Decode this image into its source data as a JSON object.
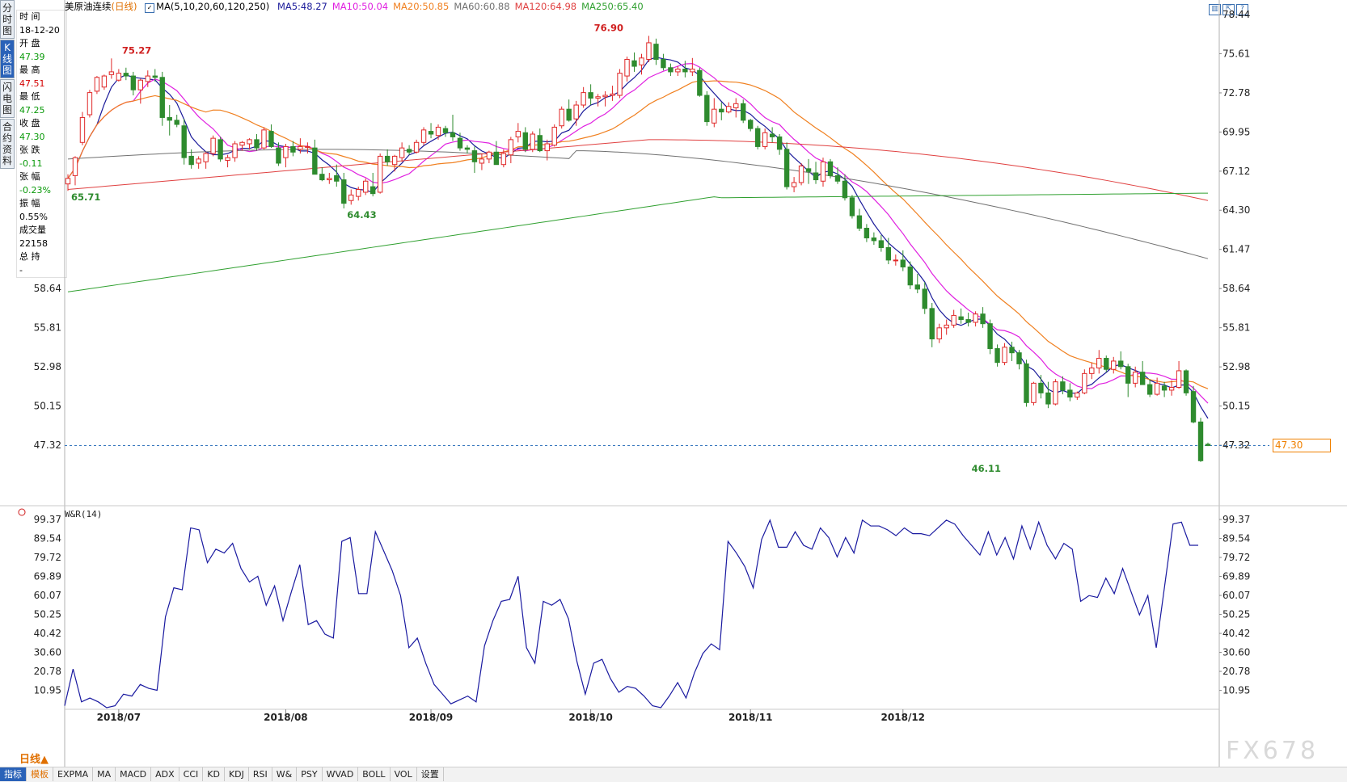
{
  "instrument": "美原油连续",
  "period_label": "(日线)",
  "ma_header": "MA(5,10,20,60,120,250)",
  "ma_values": [
    {
      "label": "MA5:48.27",
      "color": "#1a1a9a"
    },
    {
      "label": "MA10:50.04",
      "color": "#e020e0"
    },
    {
      "label": "MA20:50.85",
      "color": "#f08020"
    },
    {
      "label": "MA60:60.88",
      "color": "#707070"
    },
    {
      "label": "MA120:64.98",
      "color": "#e04040"
    },
    {
      "label": "MA250:65.40",
      "color": "#30a030"
    }
  ],
  "side_tabs": [
    "分时图",
    "K线图",
    "闪电图",
    "合约资料"
  ],
  "info_panel": [
    {
      "label": "时 间",
      "value": "18-12-20",
      "cls": ""
    },
    {
      "label": "开 盘",
      "value": "47.39",
      "cls": "g"
    },
    {
      "label": "最 高",
      "value": "47.51",
      "cls": "r"
    },
    {
      "label": "最 低",
      "value": "47.25",
      "cls": "g"
    },
    {
      "label": "收 盘",
      "value": "47.30",
      "cls": "g"
    },
    {
      "label": "张 跌",
      "value": "-0.11",
      "cls": "g"
    },
    {
      "label": "张 幅",
      "value": "-0.23%",
      "cls": "g"
    },
    {
      "label": "振 幅",
      "value": "0.55%",
      "cls": ""
    },
    {
      "label": "成交量",
      "value": "22158",
      "cls": ""
    },
    {
      "label": "总 持",
      "value": "-",
      "cls": ""
    }
  ],
  "current_price": "47.30",
  "timeframe_button": "日线▲",
  "indicator_tabs": [
    "指标",
    "模板",
    "EXPMA",
    "MA",
    "MACD",
    "ADX",
    "CCI",
    "KD",
    "KDJ",
    "RSI",
    "W&",
    "PSY",
    "WVAD",
    "BOLL",
    "VOL",
    "设置"
  ],
  "watermark": "FX678",
  "wr_title": "W&R(14)",
  "colors": {
    "up": "#e02828",
    "down": "#2e8b2e",
    "ma5": "#1a1a9a",
    "ma10": "#e020e0",
    "ma20": "#f08020",
    "ma60": "#707070",
    "ma120": "#e04040",
    "ma250": "#30a030",
    "wr": "#1a1aa0"
  },
  "chart_data": [
    {
      "type": "candlestick",
      "y_ticks": [
        "78.44",
        "75.61",
        "72.78",
        "69.95",
        "67.12",
        "64.30",
        "61.47",
        "58.64",
        "55.81",
        "52.98",
        "50.15",
        "47.32"
      ],
      "ylim": [
        45.7,
        78.44
      ],
      "x_labels": [
        "2018/07",
        "2018/08",
        "2018/09",
        "2018/10",
        "2018/11",
        "2018/12"
      ],
      "x_label_index": [
        7,
        30,
        50,
        72,
        94,
        115
      ],
      "annotations": [
        {
          "text": "75.27",
          "index": 7,
          "price": 75.27,
          "color": "#d02020"
        },
        {
          "text": "65.71",
          "index": 0,
          "price": 65.71,
          "color": "#2e8b2e"
        },
        {
          "text": "64.43",
          "index": 38,
          "price": 64.43,
          "color": "#2e8b2e"
        },
        {
          "text": "76.90",
          "index": 72,
          "price": 76.9,
          "color": "#d02020"
        },
        {
          "text": "46.11",
          "index": 124,
          "price": 46.11,
          "color": "#2e8b2e"
        }
      ],
      "start_date": "2018-06-22",
      "ohlc": [
        [
          66.2,
          66.9,
          65.7,
          66.6
        ],
        [
          66.8,
          68.2,
          66.1,
          68.1
        ],
        [
          69.2,
          71.4,
          69.0,
          71.0
        ],
        [
          71.2,
          73.0,
          71.0,
          72.8
        ],
        [
          72.9,
          74.0,
          72.7,
          73.9
        ],
        [
          73.2,
          74.1,
          73.0,
          74.0
        ],
        [
          74.1,
          75.27,
          73.8,
          74.3
        ],
        [
          73.7,
          74.5,
          73.6,
          74.2
        ],
        [
          74.2,
          74.6,
          73.7,
          74.0
        ],
        [
          74.0,
          74.3,
          72.6,
          73.0
        ],
        [
          73.0,
          73.8,
          72.0,
          73.7
        ],
        [
          73.6,
          74.4,
          73.2,
          74.0
        ],
        [
          74.0,
          74.5,
          73.6,
          73.9
        ],
        [
          73.9,
          74.3,
          70.4,
          71.0
        ],
        [
          71.0,
          71.9,
          69.7,
          70.8
        ],
        [
          70.8,
          71.2,
          70.3,
          70.5
        ],
        [
          70.4,
          70.9,
          67.6,
          68.1
        ],
        [
          68.2,
          68.7,
          67.3,
          67.6
        ],
        [
          67.7,
          68.2,
          67.3,
          68.0
        ],
        [
          67.8,
          68.5,
          67.3,
          68.4
        ],
        [
          68.4,
          69.7,
          68.2,
          69.5
        ],
        [
          69.4,
          69.6,
          67.8,
          68.0
        ],
        [
          67.9,
          68.3,
          67.4,
          68.1
        ],
        [
          68.1,
          69.3,
          67.8,
          69.1
        ],
        [
          69.0,
          69.3,
          68.6,
          69.2
        ],
        [
          69.1,
          69.5,
          68.7,
          69.4
        ],
        [
          69.4,
          69.8,
          68.6,
          68.8
        ],
        [
          68.8,
          70.3,
          68.7,
          70.1
        ],
        [
          70.0,
          70.5,
          68.8,
          68.9
        ],
        [
          68.8,
          69.2,
          67.5,
          67.7
        ],
        [
          68.1,
          69.1,
          67.4,
          68.9
        ],
        [
          68.9,
          69.3,
          68.2,
          68.5
        ],
        [
          68.7,
          69.5,
          68.4,
          68.9
        ],
        [
          68.9,
          69.2,
          68.4,
          68.9
        ],
        [
          68.8,
          69.4,
          68.1,
          66.9
        ],
        [
          66.9,
          67.4,
          66.4,
          66.5
        ],
        [
          66.5,
          67.0,
          66.2,
          66.6
        ],
        [
          66.8,
          67.6,
          66.0,
          66.4
        ],
        [
          66.5,
          67.0,
          64.43,
          64.8
        ],
        [
          65.0,
          65.8,
          64.7,
          65.4
        ],
        [
          65.3,
          66.0,
          65.0,
          65.8
        ],
        [
          65.6,
          66.6,
          65.4,
          66.4
        ],
        [
          66.0,
          67.0,
          65.3,
          65.5
        ],
        [
          65.6,
          68.4,
          65.5,
          68.2
        ],
        [
          68.2,
          68.7,
          67.5,
          67.8
        ],
        [
          67.6,
          68.3,
          67.1,
          68.2
        ],
        [
          68.1,
          69.2,
          67.8,
          68.8
        ],
        [
          68.7,
          69.0,
          68.3,
          68.5
        ],
        [
          68.5,
          69.4,
          68.4,
          69.2
        ],
        [
          69.2,
          70.3,
          69.0,
          70.1
        ],
        [
          70.0,
          70.6,
          69.5,
          69.8
        ],
        [
          69.7,
          70.5,
          69.4,
          70.3
        ],
        [
          70.2,
          70.4,
          69.6,
          69.9
        ],
        [
          69.9,
          71.2,
          69.3,
          69.6
        ],
        [
          69.5,
          69.9,
          68.6,
          68.8
        ],
        [
          68.8,
          69.0,
          68.4,
          68.7
        ],
        [
          68.6,
          68.9,
          67.0,
          67.8
        ],
        [
          67.7,
          68.4,
          67.2,
          68.0
        ],
        [
          68.0,
          68.6,
          67.7,
          68.5
        ],
        [
          68.5,
          69.3,
          67.8,
          67.6
        ],
        [
          67.6,
          68.7,
          67.4,
          68.4
        ],
        [
          68.3,
          69.6,
          67.7,
          69.4
        ],
        [
          69.6,
          70.6,
          69.2,
          70.0
        ],
        [
          69.9,
          70.3,
          68.5,
          68.7
        ],
        [
          68.7,
          70.0,
          68.5,
          69.8
        ],
        [
          69.7,
          70.2,
          68.5,
          68.6
        ],
        [
          68.6,
          69.4,
          67.9,
          69.1
        ],
        [
          69.0,
          70.5,
          68.9,
          70.3
        ],
        [
          70.4,
          71.8,
          70.2,
          71.6
        ],
        [
          71.6,
          72.3,
          70.7,
          70.8
        ],
        [
          70.9,
          72.2,
          70.4,
          71.9
        ],
        [
          71.9,
          73.2,
          71.7,
          72.8
        ],
        [
          72.8,
          73.4,
          71.9,
          72.4
        ],
        [
          72.4,
          72.7,
          71.8,
          72.5
        ],
        [
          72.5,
          72.9,
          71.8,
          72.6
        ],
        [
          72.6,
          73.3,
          72.2,
          72.7
        ],
        [
          72.6,
          74.5,
          72.4,
          74.2
        ],
        [
          74.0,
          75.4,
          73.6,
          75.2
        ],
        [
          75.1,
          75.7,
          74.3,
          74.7
        ],
        [
          74.8,
          75.6,
          74.1,
          75.3
        ],
        [
          75.2,
          76.9,
          75.0,
          76.4
        ],
        [
          76.3,
          76.7,
          74.8,
          75.2
        ],
        [
          75.2,
          75.6,
          74.4,
          74.6
        ],
        [
          74.6,
          74.9,
          74.0,
          74.3
        ],
        [
          74.3,
          74.7,
          74.0,
          74.5
        ],
        [
          74.5,
          75.1,
          73.9,
          74.3
        ],
        [
          74.3,
          75.3,
          74.0,
          74.5
        ],
        [
          74.4,
          74.6,
          72.5,
          72.6
        ],
        [
          72.6,
          72.9,
          70.4,
          70.7
        ],
        [
          70.6,
          72.4,
          70.3,
          71.6
        ],
        [
          71.6,
          72.1,
          70.8,
          71.4
        ],
        [
          71.4,
          72.1,
          71.3,
          71.8
        ],
        [
          71.7,
          72.4,
          71.0,
          72.0
        ],
        [
          72.0,
          72.3,
          70.6,
          70.8
        ],
        [
          70.8,
          70.9,
          70.0,
          70.2
        ],
        [
          70.2,
          70.4,
          68.7,
          68.9
        ],
        [
          68.9,
          70.2,
          68.7,
          69.9
        ],
        [
          69.8,
          70.3,
          69.2,
          69.6
        ],
        [
          69.6,
          69.8,
          68.3,
          68.7
        ],
        [
          68.7,
          69.2,
          65.8,
          66.0
        ],
        [
          66.0,
          66.7,
          65.6,
          66.3
        ],
        [
          66.3,
          67.7,
          66.1,
          67.5
        ],
        [
          67.3,
          68.0,
          66.2,
          67.1
        ],
        [
          67.0,
          67.8,
          66.2,
          66.5
        ],
        [
          66.4,
          68.1,
          66.0,
          67.8
        ],
        [
          67.8,
          68.0,
          66.6,
          66.8
        ],
        [
          66.8,
          67.4,
          66.2,
          66.4
        ],
        [
          66.4,
          66.9,
          65.0,
          65.2
        ],
        [
          65.2,
          65.4,
          63.7,
          63.9
        ],
        [
          63.9,
          64.4,
          62.8,
          63.0
        ],
        [
          63.0,
          63.3,
          62.0,
          62.3
        ],
        [
          62.3,
          62.7,
          61.8,
          62.1
        ],
        [
          62.1,
          62.5,
          61.3,
          61.6
        ],
        [
          61.6,
          62.3,
          60.4,
          60.7
        ],
        [
          60.7,
          61.1,
          60.3,
          60.7
        ],
        [
          60.7,
          61.4,
          59.9,
          60.2
        ],
        [
          60.2,
          60.6,
          58.6,
          58.9
        ],
        [
          58.9,
          59.7,
          58.3,
          58.6
        ],
        [
          58.6,
          59.1,
          56.8,
          57.2
        ],
        [
          57.2,
          57.6,
          54.4,
          55.0
        ],
        [
          55.0,
          56.1,
          54.7,
          55.8
        ],
        [
          55.8,
          56.4,
          55.3,
          56.0
        ],
        [
          56.0,
          57.1,
          55.8,
          56.7
        ],
        [
          56.6,
          57.2,
          56.1,
          56.4
        ],
        [
          56.4,
          56.9,
          55.9,
          56.2
        ],
        [
          56.2,
          57.0,
          55.9,
          56.8
        ],
        [
          56.8,
          57.3,
          55.8,
          56.1
        ],
        [
          56.1,
          56.4,
          53.9,
          54.3
        ],
        [
          54.3,
          54.6,
          53.0,
          53.3
        ],
        [
          53.3,
          54.7,
          53.1,
          54.4
        ],
        [
          54.4,
          54.8,
          53.4,
          54.0
        ],
        [
          54.0,
          54.2,
          52.8,
          53.2
        ],
        [
          53.2,
          53.5,
          50.1,
          50.4
        ],
        [
          50.4,
          51.9,
          50.2,
          51.8
        ],
        [
          51.8,
          52.4,
          50.7,
          51.1
        ],
        [
          51.1,
          51.9,
          50.0,
          50.3
        ],
        [
          50.3,
          52.1,
          50.2,
          51.9
        ],
        [
          51.9,
          52.3,
          51.0,
          51.3
        ],
        [
          51.3,
          51.8,
          50.5,
          50.8
        ],
        [
          50.8,
          51.2,
          50.6,
          51.1
        ],
        [
          51.1,
          52.8,
          51.0,
          52.5
        ],
        [
          52.5,
          53.3,
          52.1,
          52.9
        ],
        [
          52.9,
          54.2,
          52.5,
          53.6
        ],
        [
          53.6,
          53.8,
          52.6,
          52.8
        ],
        [
          52.8,
          53.7,
          52.5,
          53.4
        ],
        [
          53.4,
          54.1,
          52.8,
          53.0
        ],
        [
          53.0,
          53.2,
          50.8,
          51.8
        ],
        [
          51.8,
          53.0,
          51.5,
          52.6
        ],
        [
          52.6,
          53.4,
          52.0,
          51.7
        ],
        [
          51.7,
          52.1,
          50.8,
          51.0
        ],
        [
          51.0,
          52.2,
          50.9,
          51.8
        ],
        [
          51.6,
          51.9,
          50.8,
          51.3
        ],
        [
          51.3,
          52.0,
          50.9,
          51.5
        ],
        [
          51.5,
          53.4,
          51.4,
          52.7
        ],
        [
          52.7,
          52.8,
          50.9,
          51.1
        ],
        [
          51.2,
          51.6,
          48.9,
          49.0
        ],
        [
          49.0,
          49.3,
          46.11,
          46.2
        ],
        [
          47.39,
          47.51,
          47.25,
          47.3
        ]
      ]
    },
    {
      "type": "line",
      "title": "W&R(14)",
      "y_ticks": [
        "99.37",
        "89.54",
        "79.72",
        "69.89",
        "60.07",
        "50.25",
        "40.42",
        "30.60",
        "20.78",
        "10.95"
      ],
      "ylim": [
        2.0,
        99.37
      ],
      "series": [
        {
          "name": "W&R(14)",
          "values": [
            3,
            22,
            5,
            7,
            5,
            2,
            3,
            9,
            8,
            14,
            12,
            11,
            49,
            64,
            63,
            95,
            94,
            77,
            84,
            82,
            87,
            74,
            67,
            70,
            55,
            65,
            47,
            62,
            76,
            45,
            47,
            40,
            38,
            88,
            90,
            61,
            61,
            93,
            83,
            73,
            60,
            33,
            38,
            25,
            14,
            9,
            4,
            6,
            8,
            5,
            34,
            47,
            57,
            58,
            70,
            33,
            25,
            57,
            55,
            58,
            48,
            26,
            9,
            25,
            27,
            17,
            10,
            13,
            12,
            8,
            3,
            2,
            8,
            15,
            7,
            20,
            30,
            35,
            32,
            88,
            82,
            75,
            64,
            89,
            99,
            85,
            85,
            93,
            86,
            84,
            95,
            90,
            80,
            90,
            82,
            99,
            96,
            96,
            94,
            91,
            95,
            92,
            92,
            91,
            95,
            99,
            97,
            91,
            86,
            81,
            93,
            81,
            90,
            79,
            96,
            84,
            98,
            86,
            79,
            87,
            84,
            57,
            60,
            59,
            69,
            61,
            74,
            62,
            50,
            60,
            33,
            65,
            97,
            98,
            86,
            86
          ]
        }
      ]
    }
  ]
}
